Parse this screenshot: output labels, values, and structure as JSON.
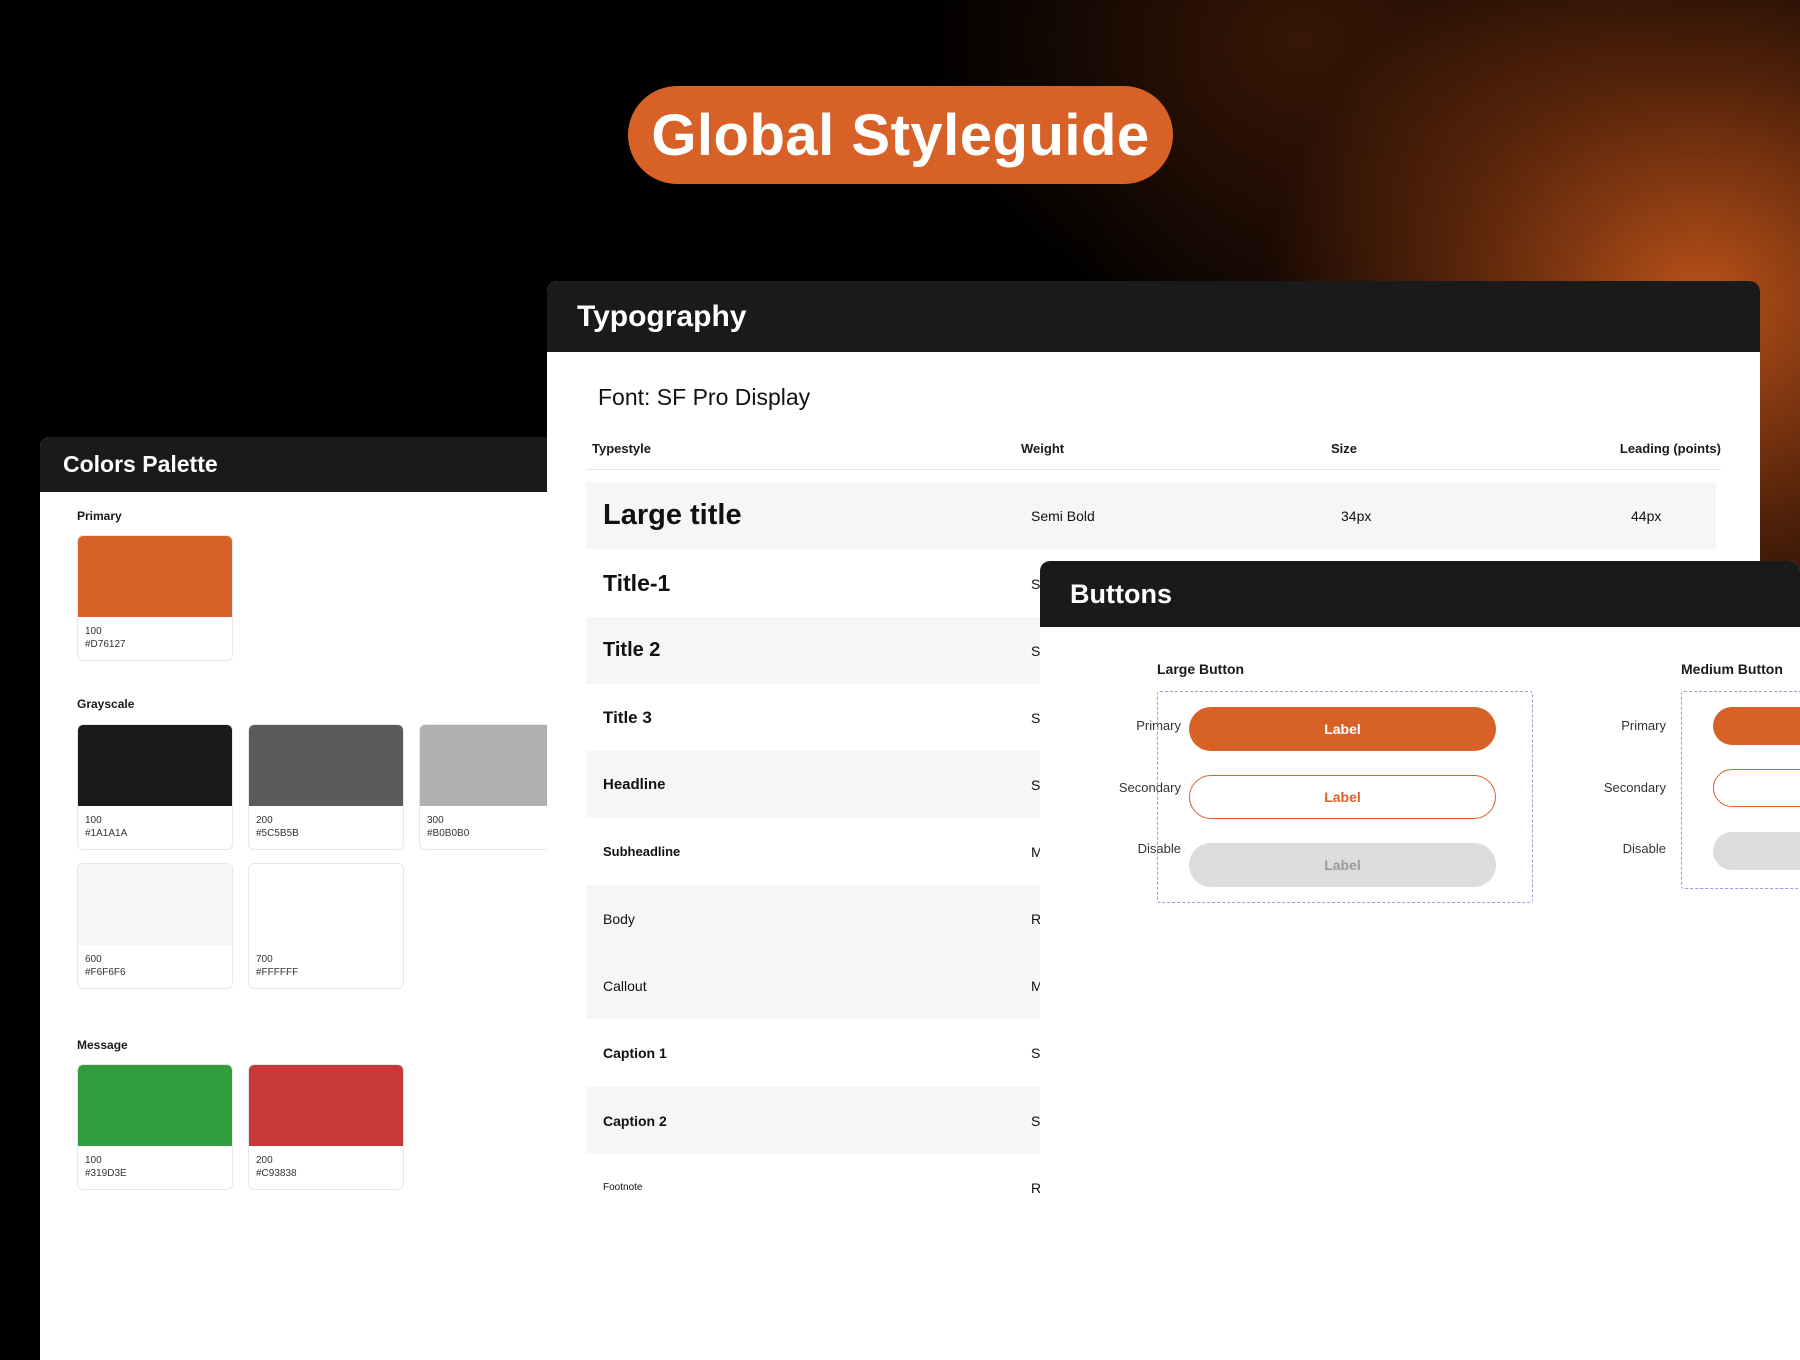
{
  "hero": {
    "title": "Global Styleguide"
  },
  "colors_panel": {
    "title": "Colors Palette",
    "sections": {
      "primary": {
        "label": "Primary",
        "swatches": [
          {
            "code": "100",
            "hex": "#D76127"
          }
        ]
      },
      "grayscale": {
        "label": "Grayscale",
        "swatches": [
          {
            "code": "100",
            "hex": "#1A1A1A"
          },
          {
            "code": "200",
            "hex": "#5C5B5B"
          },
          {
            "code": "300",
            "hex": "#B0B0B0"
          },
          {
            "code": "600",
            "hex": "#F6F6F6"
          },
          {
            "code": "700",
            "hex": "#FFFFFF"
          }
        ]
      },
      "message": {
        "label": "Message",
        "swatches": [
          {
            "code": "100",
            "hex": "#319D3E"
          },
          {
            "code": "200",
            "hex": "#C93838"
          }
        ]
      }
    }
  },
  "typography_panel": {
    "title": "Typography",
    "font_label": "Font: SF Pro Display",
    "headers": {
      "typestyle": "Typestyle",
      "weight": "Weight",
      "size": "Size",
      "leading": "Leading (points)"
    },
    "rows": [
      {
        "name": "Large title",
        "weight": "Semi Bold",
        "size": "34px",
        "leading": "44px"
      },
      {
        "name": "Title-1",
        "weight": "S"
      },
      {
        "name": "Title 2",
        "weight": "S"
      },
      {
        "name": "Title 3",
        "weight": "S"
      },
      {
        "name": "Headline",
        "weight": "S"
      },
      {
        "name": "Subheadline",
        "weight": "M"
      },
      {
        "name": "Body",
        "weight": "R"
      },
      {
        "name": "Callout",
        "weight": "M"
      },
      {
        "name": "Caption 1",
        "weight": "S"
      },
      {
        "name": "Caption 2",
        "weight": "S"
      },
      {
        "name": "Footnote",
        "weight": "R"
      }
    ]
  },
  "buttons_panel": {
    "title": "Buttons",
    "large_group": {
      "title": "Large Button",
      "row_labels": {
        "primary": "Primary",
        "secondary": "Secondary",
        "disable": "Disable"
      },
      "buttons": {
        "primary": "Label",
        "secondary": "Label",
        "disabled": "Label"
      }
    },
    "medium_group": {
      "title": "Medium Button",
      "row_labels": {
        "primary": "Primary",
        "secondary": "Secondary",
        "disable": "Disable"
      }
    }
  }
}
